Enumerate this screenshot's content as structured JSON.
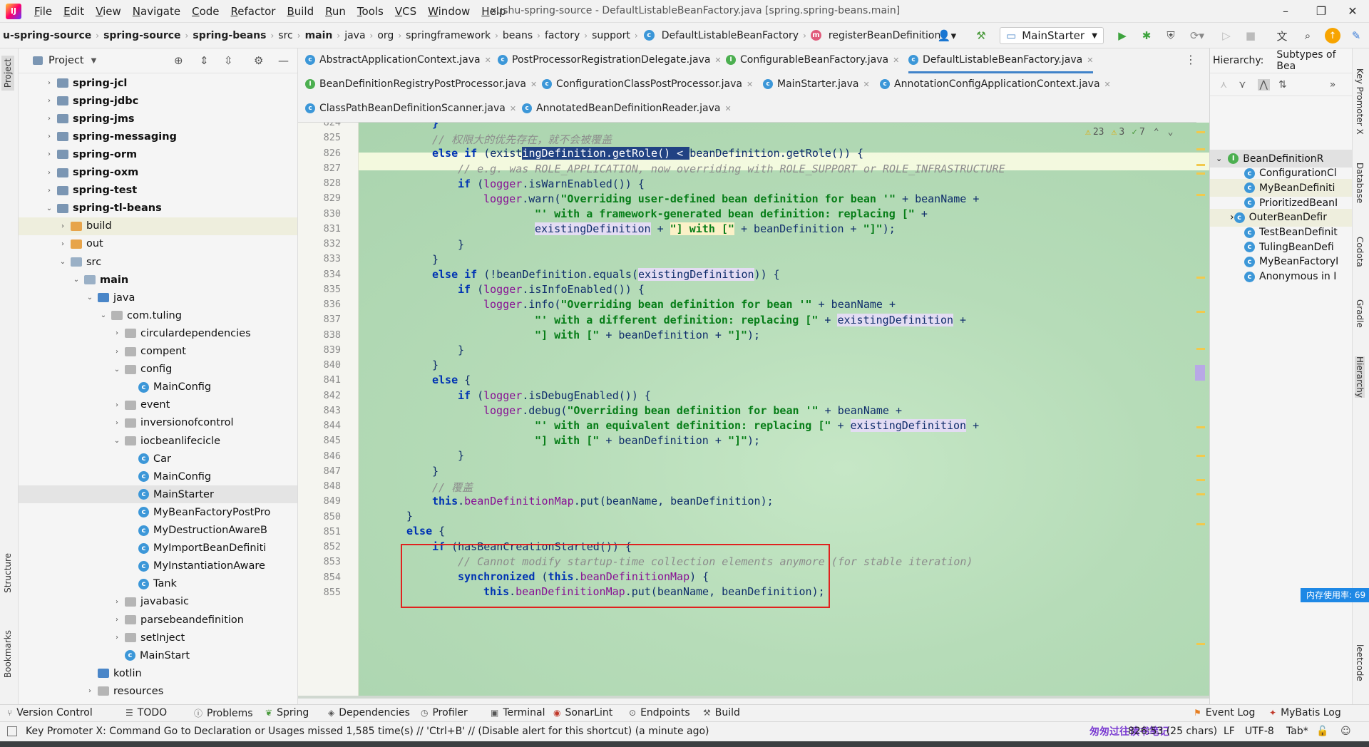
{
  "menubar": {
    "items": [
      "File",
      "Edit",
      "View",
      "Navigate",
      "Code",
      "Refactor",
      "Build",
      "Run",
      "Tools",
      "VCS",
      "Window",
      "Help"
    ],
    "window_title": "xushu-spring-source - DefaultListableBeanFactory.java [spring.spring-beans.main]"
  },
  "breadcrumb": {
    "items": [
      "u-spring-source",
      "spring-source",
      "spring-beans",
      "src",
      "main",
      "java",
      "org",
      "springframework",
      "beans",
      "factory",
      "support",
      "DefaultListableBeanFactory",
      "registerBeanDefinition"
    ]
  },
  "toolbar": {
    "run_config": "MainStarter"
  },
  "left_stripe": {
    "project": "Project",
    "structure": "Structure",
    "bookmarks": "Bookmarks"
  },
  "project": {
    "title": "Project",
    "tree": [
      {
        "label": "spring-jcl",
        "bold": true
      },
      {
        "label": "spring-jdbc",
        "bold": true
      },
      {
        "label": "spring-jms",
        "bold": true
      },
      {
        "label": "spring-messaging",
        "bold": true
      },
      {
        "label": "spring-orm",
        "bold": true
      },
      {
        "label": "spring-oxm",
        "bold": true
      },
      {
        "label": "spring-test",
        "bold": true
      },
      {
        "label": "spring-tl-beans",
        "bold": true
      },
      {
        "label": "build"
      },
      {
        "label": "out"
      },
      {
        "label": "src"
      },
      {
        "label": "main",
        "bold": true
      },
      {
        "label": "java"
      },
      {
        "label": "com.tuling"
      },
      {
        "label": "circulardependencies"
      },
      {
        "label": "compent"
      },
      {
        "label": "config"
      },
      {
        "label": "MainConfig"
      },
      {
        "label": "event"
      },
      {
        "label": "inversionofcontrol"
      },
      {
        "label": "iocbeanlifecicle"
      },
      {
        "label": "Car"
      },
      {
        "label": "MainConfig"
      },
      {
        "label": "MainStarter"
      },
      {
        "label": "MyBeanFactoryPostPro"
      },
      {
        "label": "MyDestructionAwareB"
      },
      {
        "label": "MyImportBeanDefiniti"
      },
      {
        "label": "MyInstantiationAware"
      },
      {
        "label": "Tank"
      },
      {
        "label": "javabasic"
      },
      {
        "label": "parsebeandefinition"
      },
      {
        "label": "setInject"
      },
      {
        "label": "MainStart"
      },
      {
        "label": "kotlin"
      },
      {
        "label": "resources"
      }
    ]
  },
  "tabs": {
    "row1": [
      "AbstractApplicationContext.java",
      "PostProcessorRegistrationDelegate.java",
      "ConfigurableBeanFactory.java",
      "DefaultListableBeanFactory.java"
    ],
    "row2": [
      "BeanDefinitionRegistryPostProcessor.java",
      "ConfigurationClassPostProcessor.java",
      "MainStarter.java",
      "AnnotationConfigApplicationContext.java"
    ],
    "row3": [
      "ClassPathBeanDefinitionScanner.java",
      "AnnotatedBeanDefinitionReader.java"
    ]
  },
  "editor": {
    "inspections": {
      "warnings": "23",
      "weak": "3",
      "ok": "7"
    },
    "line_numbers": [
      "824",
      "825",
      "826",
      "827",
      "828",
      "829",
      "830",
      "831",
      "832",
      "833",
      "834",
      "835",
      "836",
      "837",
      "838",
      "839",
      "840",
      "841",
      "842",
      "843",
      "844",
      "845",
      "846",
      "847",
      "848",
      "849",
      "850",
      "851",
      "852",
      "853",
      "854",
      "855"
    ],
    "comment_825": "// 权限大的优先存在，就不会被覆盖",
    "comment_827": "// e.g. was ROLE_APPLICATION, now overriding with ROLE_SUPPORT or ROLE_INFRASTRUCTURE",
    "comment_848": "// 覆盖",
    "comment_853": "// Cannot modify startup-time collection elements anymore (for stable iteration)",
    "str_829": "\"Overriding user-defined bean definition for bean '\"",
    "str_830": "\"' with a framework-generated bean definition: replacing [\"",
    "str_831a": "\"] with [\"",
    "str_831b": "\"]\"",
    "str_836": "\"Overriding bean definition for bean '\"",
    "str_837": "\"' with a different definition: replacing [\"",
    "str_838a": "\"] with [\"",
    "str_838b": "\"]\"",
    "str_843": "\"Overriding bean definition for bean '\"",
    "str_844": "\"' with an equivalent definition: replacing [\"",
    "str_845a": "\"] with [\"",
    "str_845b": "\"]\""
  },
  "hierarchy": {
    "title": "Hierarchy:",
    "mode": "Subtypes of Bea",
    "items": [
      "BeanDefinitionR",
      "ConfigurationCl",
      "MyBeanDefiniti",
      "PrioritizedBeanI",
      "OuterBeanDefir",
      "TestBeanDefinit",
      "TulingBeanDefi",
      "MyBeanFactoryI",
      "Anonymous in I"
    ]
  },
  "right_stripe": [
    "Key Promoter X",
    "Database",
    "Codota",
    "Gradle",
    "Hierarchy",
    "leetcode"
  ],
  "memory_badge": "内存使用率: 69",
  "bottom_tools": [
    "Version Control",
    "TODO",
    "Problems",
    "Spring",
    "Dependencies",
    "Profiler",
    "Terminal",
    "SonarLint",
    "Endpoints",
    "Build",
    "Event Log",
    "MyBatis Log"
  ],
  "status": {
    "message": "Key Promoter X: Command Go to Declaration or Usages missed 1,585 time(s) // 'Ctrl+B' // (Disable alert for this shortcut) (a minute ago)",
    "position": "826:53 (25 chars)",
    "line_sep": "LF",
    "encoding": "UTF-8",
    "indent": "Tab*",
    "watermark": "匆匆过往读书笔记"
  }
}
